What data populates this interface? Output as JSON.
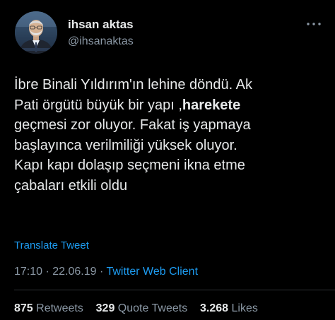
{
  "colors": {
    "background": "#000000",
    "text_primary": "#e7e9ea",
    "text_secondary": "#8b98a5",
    "link": "#1d9bf0",
    "divider": "#2f3336"
  },
  "author": {
    "display_name": "ihsan aktas",
    "handle": "@ihsanaktas",
    "avatar_icon": "profile-photo"
  },
  "menu_icon": "more-horizontal-icon",
  "tweet": {
    "lines": [
      {
        "text": "İbre Binali Yıldırım'ın lehine döndü. Ak"
      },
      {
        "text_before": "Pati örgütü büyük bir yapı ,",
        "bold": "harekete"
      },
      {
        "text": "geçmesi zor oluyor. Fakat iş yapmaya"
      },
      {
        "text": "başlayınca verilmiliği yüksek oluyor."
      },
      {
        "text": "Kapı kapı dolaşıp seçmeni ikna etme"
      },
      {
        "text": "çabaları etkili oldu"
      }
    ]
  },
  "translate_label": "Translate Tweet",
  "meta": {
    "time": "17:10",
    "separator1": " · ",
    "date": "22.06.19",
    "separator2": " · ",
    "client": "Twitter Web Client"
  },
  "stats": {
    "retweets_count": "875",
    "retweets_label": "Retweets",
    "quote_count": "329",
    "quote_label": "Quote Tweets",
    "likes_count": "3.268",
    "likes_label": "Likes"
  }
}
